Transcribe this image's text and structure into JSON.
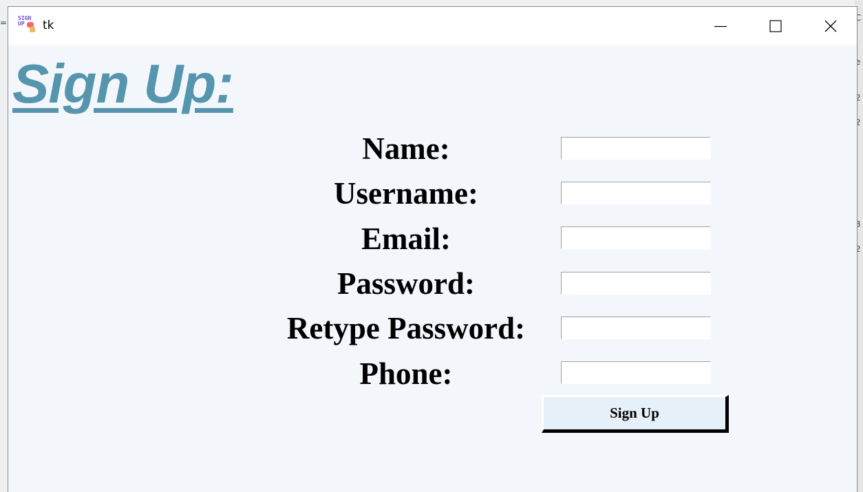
{
  "window": {
    "title": "tk",
    "icon_text_line1": "SIGN",
    "icon_text_line2": "UP"
  },
  "heading": "Sign Up:",
  "form": {
    "fields": [
      {
        "label": "Name:",
        "value": ""
      },
      {
        "label": "Username:",
        "value": ""
      },
      {
        "label": "Email:",
        "value": ""
      },
      {
        "label": "Password:",
        "value": ""
      },
      {
        "label": "Retype Password:",
        "value": ""
      },
      {
        "label": "Phone:",
        "value": ""
      }
    ],
    "submit_label": "Sign Up"
  },
  "background": {
    "left_mark": "=",
    "right_marks": [
      "C",
      "e",
      "2",
      "2",
      "3",
      "2"
    ]
  },
  "colors": {
    "heading": "#5595ad",
    "content_bg": "#f3f7fc",
    "button_bg": "#e6f0f8"
  }
}
